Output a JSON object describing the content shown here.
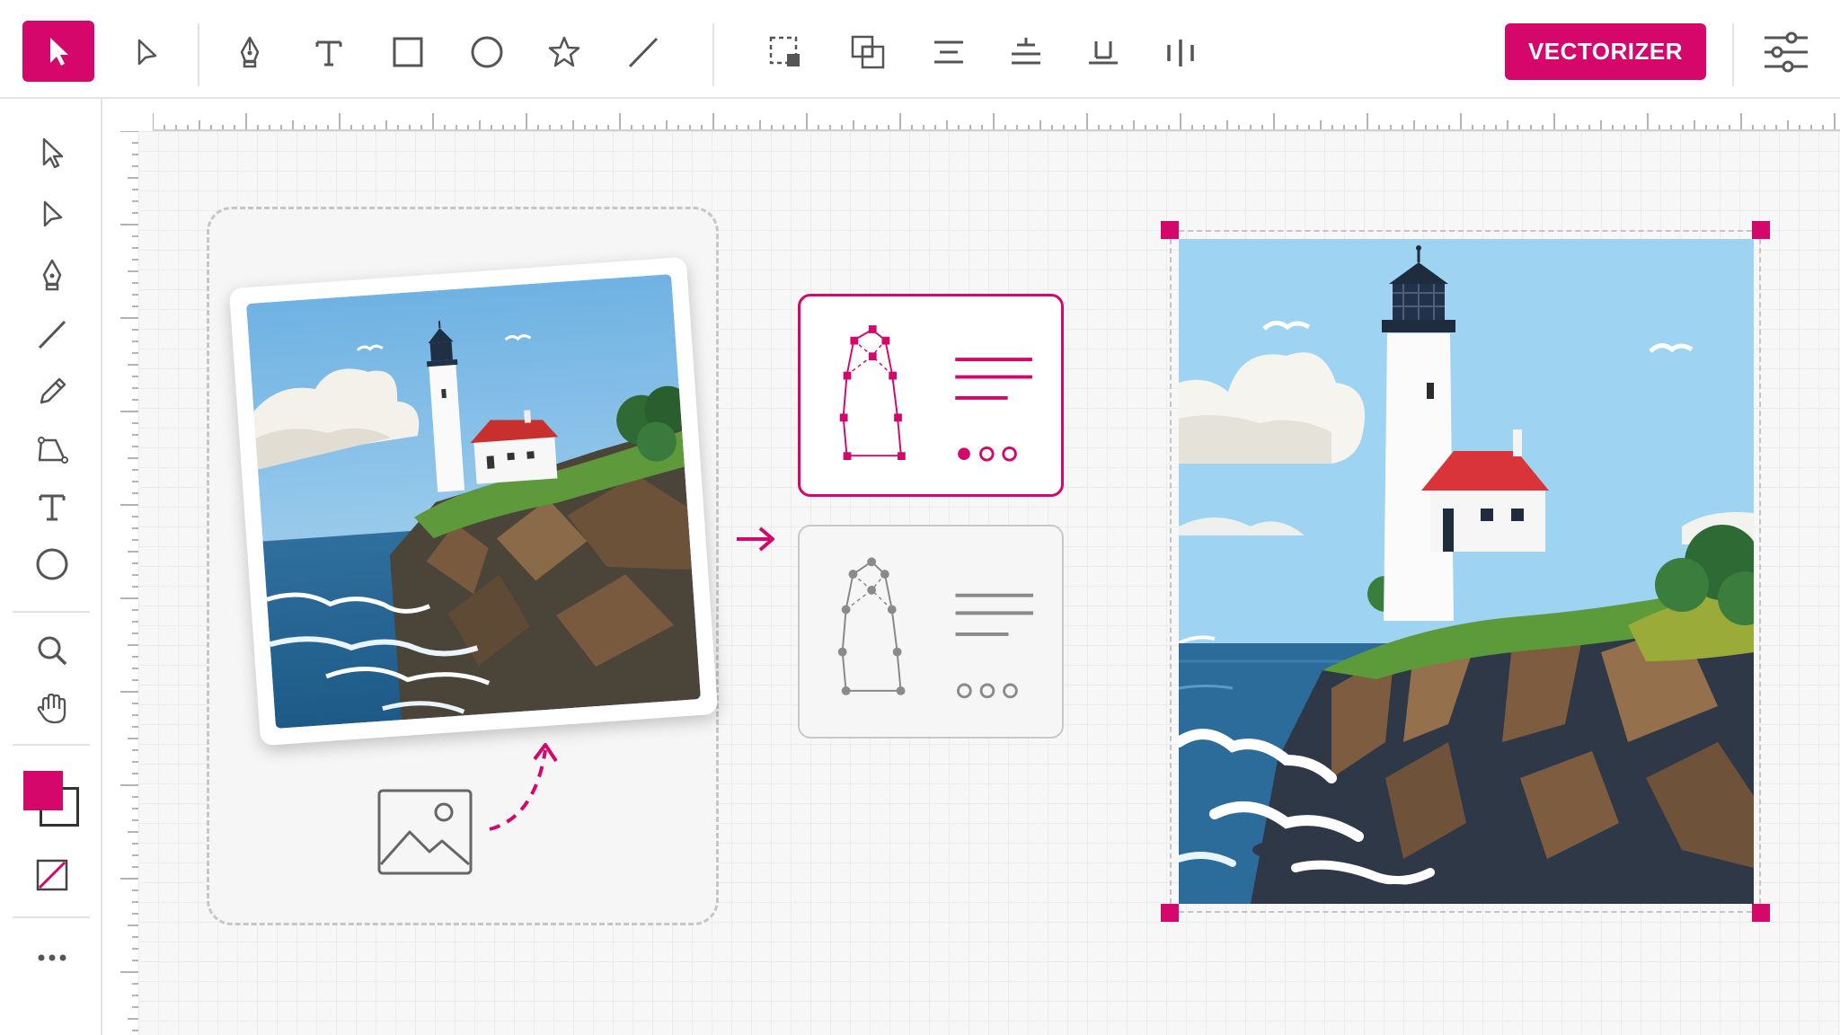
{
  "toolbar": {
    "tools": [
      {
        "id": "select",
        "icon": "select-arrow-icon",
        "active": true
      },
      {
        "id": "direct-select",
        "icon": "direct-select-icon",
        "active": false
      },
      {
        "id": "pen",
        "icon": "pen-tool-icon"
      },
      {
        "id": "text",
        "icon": "text-tool-icon"
      },
      {
        "id": "rectangle",
        "icon": "rectangle-tool-icon"
      },
      {
        "id": "ellipse",
        "icon": "ellipse-tool-icon"
      },
      {
        "id": "star",
        "icon": "star-tool-icon"
      },
      {
        "id": "line",
        "icon": "line-tool-icon"
      },
      {
        "id": "marquee",
        "icon": "marquee-select-icon"
      },
      {
        "id": "group",
        "icon": "group-objects-icon"
      },
      {
        "id": "align-left",
        "icon": "align-left-icon"
      },
      {
        "id": "align-top",
        "icon": "align-top-icon"
      },
      {
        "id": "align-bottom",
        "icon": "align-bottom-icon"
      },
      {
        "id": "distribute",
        "icon": "distribute-icon"
      }
    ],
    "primary_action": "VECTORIZER",
    "settings_icon": "sliders-settings-icon"
  },
  "left_panel": {
    "tools": [
      "select-arrow-icon",
      "direct-select-icon",
      "pen-tool-icon",
      "line-tool-icon",
      "pencil-tool-icon",
      "shape-builder-icon",
      "text-tool-icon",
      "ellipse-tool-icon",
      "zoom-icon",
      "hand-pan-icon",
      "fill-stroke-swatch-icon",
      "no-fill-icon",
      "more-options-icon"
    ],
    "fill_color": "#d6076b",
    "stroke_color": "#ffffff"
  },
  "colors": {
    "accent": "#d6076b",
    "sky": "#8fc9ec",
    "sea": "#2d6e9c",
    "roof": "#d9343a",
    "grass": "#5f9a3a",
    "rock": "#3c4650"
  },
  "canvas": {
    "source_image": "lighthouse-photo",
    "result_image": "lighthouse-vector",
    "options": [
      {
        "id": "detailed-vector",
        "selected": true
      },
      {
        "id": "simple-vector",
        "selected": false
      }
    ]
  }
}
